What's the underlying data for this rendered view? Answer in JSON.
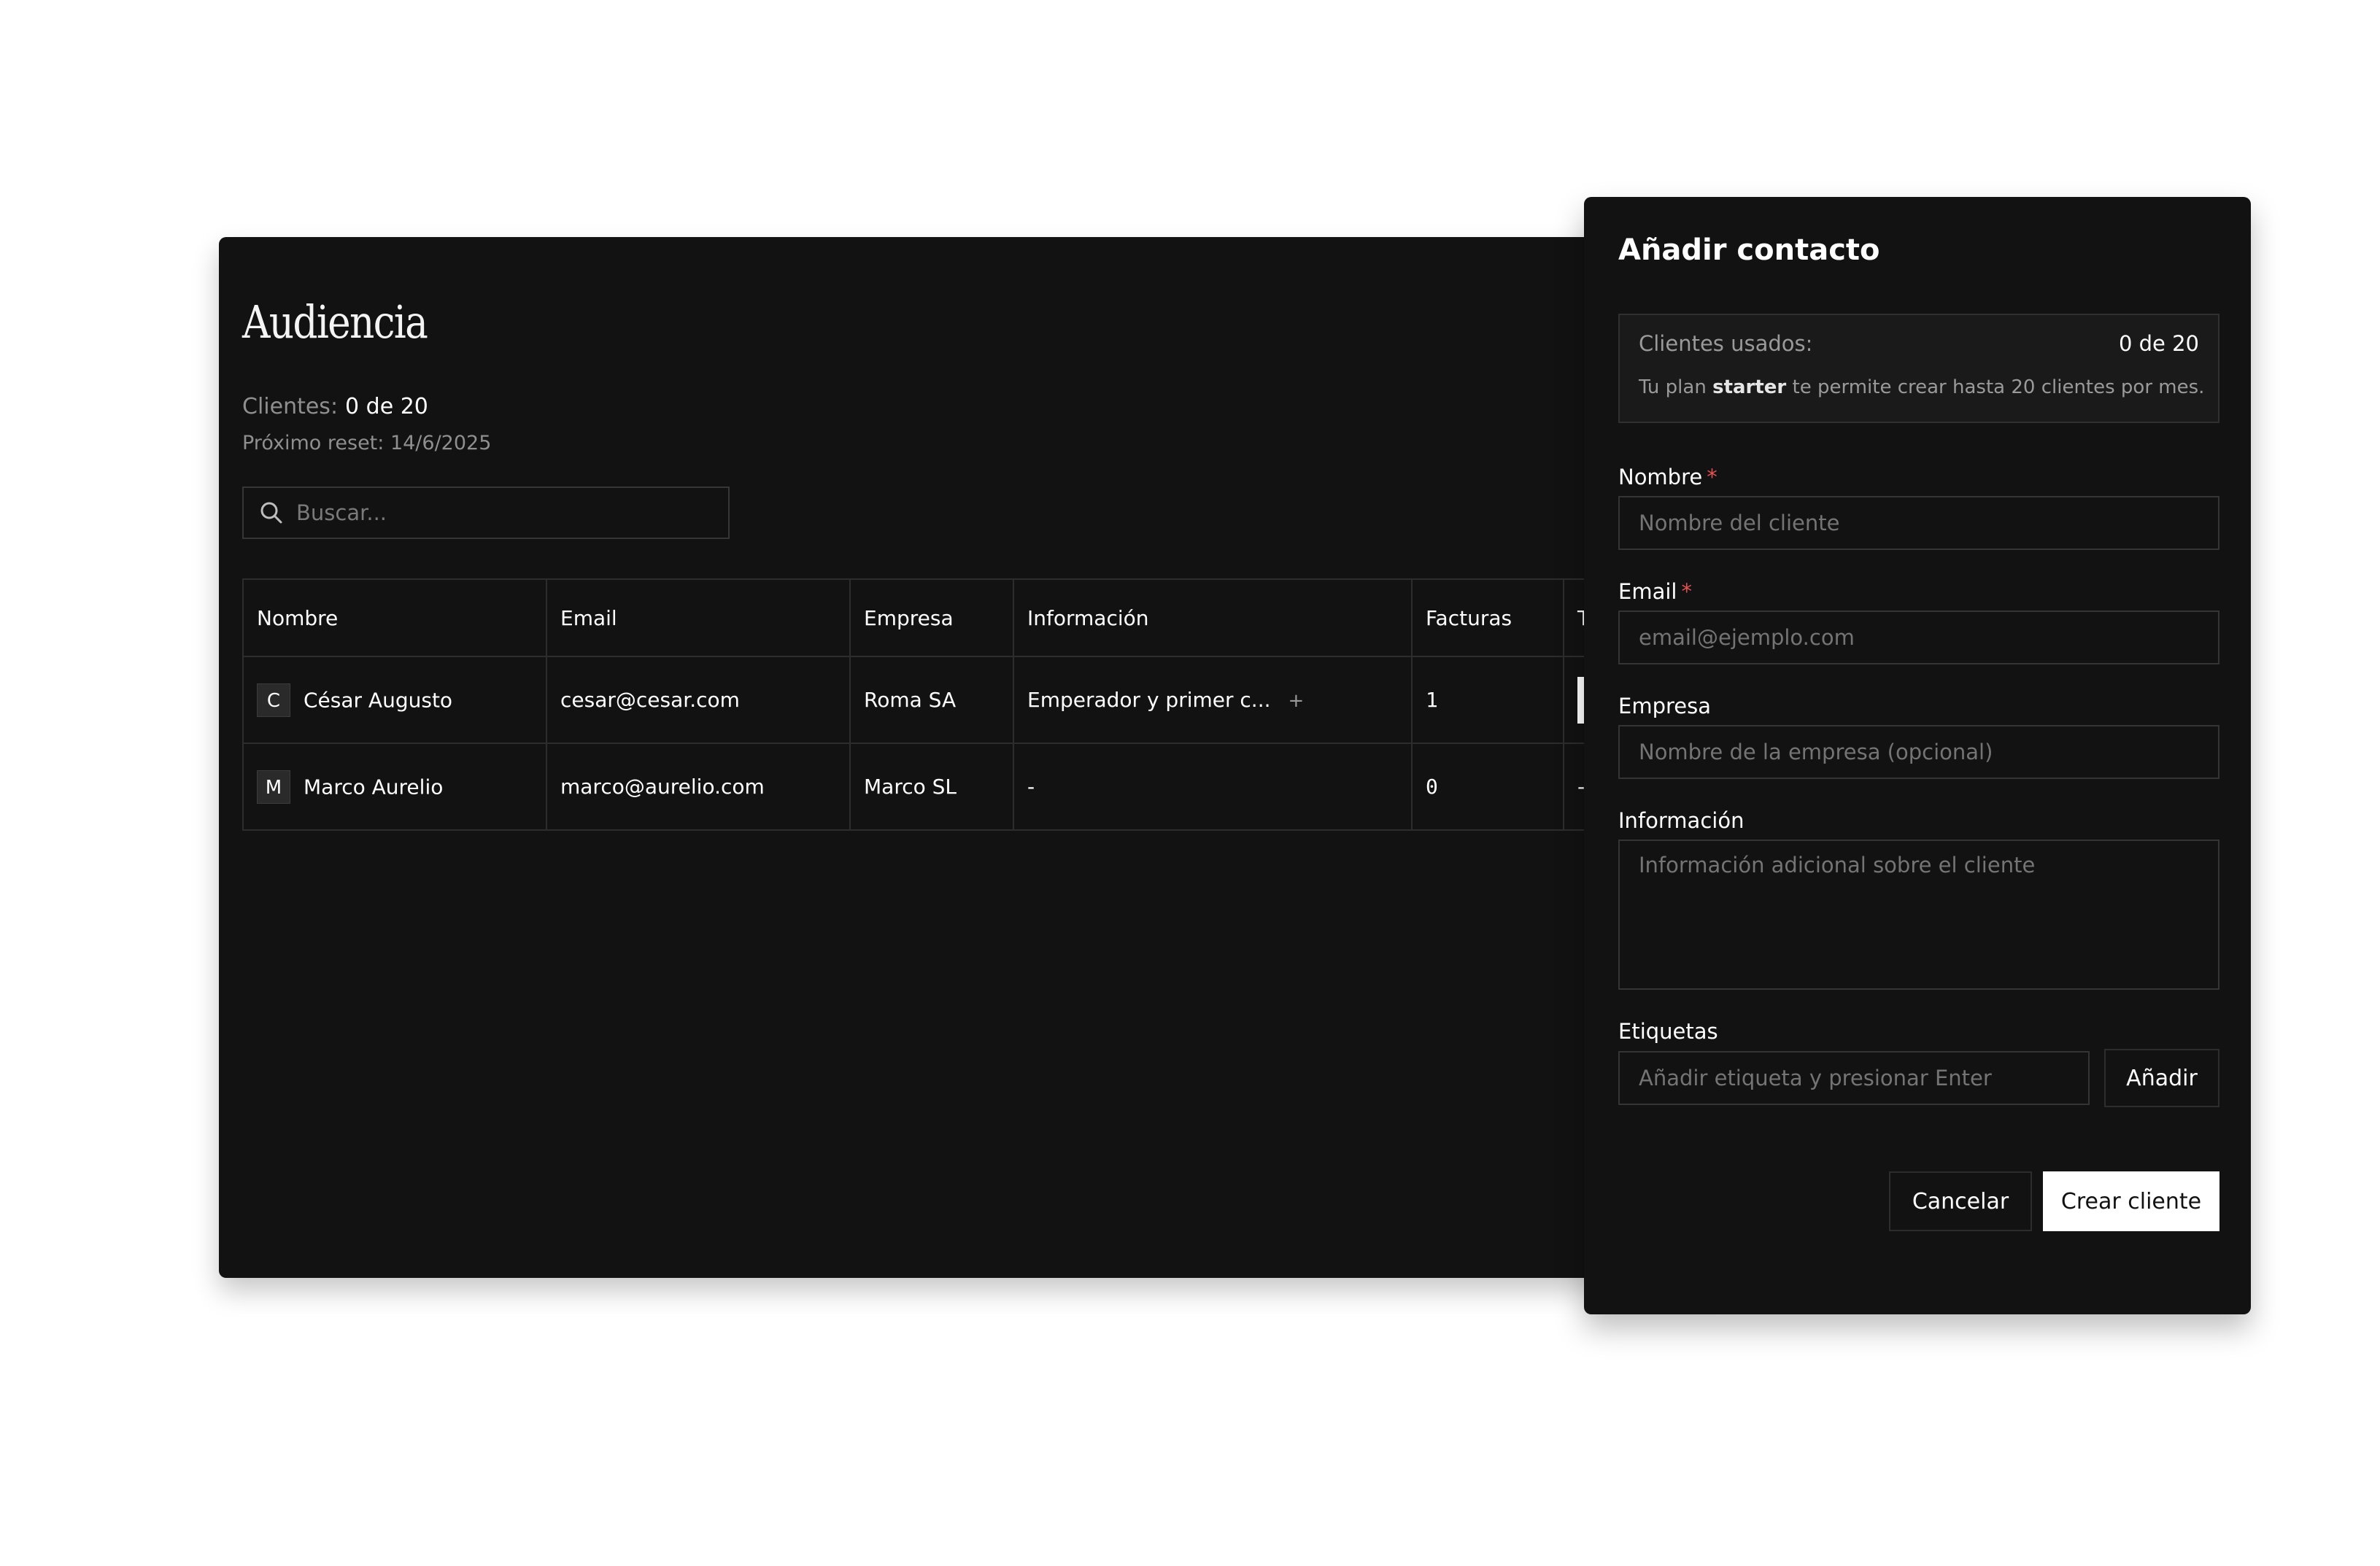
{
  "audience": {
    "title": "Audiencia",
    "clients_label": "Clientes:",
    "clients_value": "0 de 20",
    "reset_text": "Próximo reset: 14/6/2025",
    "search": {
      "placeholder": "Buscar..."
    },
    "table": {
      "columns": [
        "Nombre",
        "Email",
        "Empresa",
        "Información",
        "Facturas",
        "T"
      ],
      "rows": [
        {
          "initial": "C",
          "name": "César Augusto",
          "email": "cesar@cesar.com",
          "company": "Roma SA",
          "info": "Emperador y primer c...",
          "info_more": "+",
          "invoices": "1",
          "tags": ""
        },
        {
          "initial": "M",
          "name": "Marco Aurelio",
          "email": "marco@aurelio.com",
          "company": "Marco SL",
          "info": "-",
          "info_more": "",
          "invoices": "0",
          "tags": "-"
        }
      ]
    }
  },
  "modal": {
    "title": "Añadir contacto",
    "usage": {
      "label": "Clientes usados:",
      "value": "0 de 20",
      "note_prefix": "Tu plan ",
      "plan": "starter",
      "note_suffix": " te permite crear hasta 20 clientes por mes."
    },
    "fields": {
      "name": {
        "label": "Nombre",
        "required_mark": "*",
        "placeholder": "Nombre del cliente"
      },
      "email": {
        "label": "Email",
        "required_mark": "*",
        "placeholder": "email@ejemplo.com"
      },
      "company": {
        "label": "Empresa",
        "placeholder": "Nombre de la empresa (opcional)"
      },
      "info": {
        "label": "Información",
        "placeholder": "Información adicional sobre el cliente"
      },
      "tags": {
        "label": "Etiquetas",
        "placeholder": "Añadir etiqueta y presionar Enter",
        "add_label": "Añadir"
      }
    },
    "actions": {
      "cancel_label": "Cancelar",
      "create_label": "Crear cliente"
    }
  },
  "colors": {
    "panel_bg": "#121212",
    "required": "#e05252",
    "primary_button_bg": "#ffffff"
  }
}
